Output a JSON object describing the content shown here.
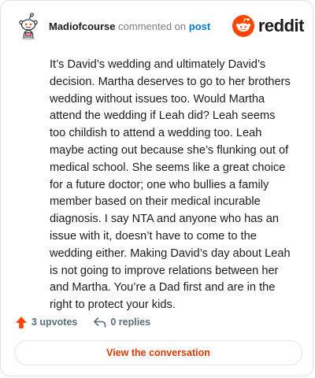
{
  "header": {
    "username": "Madiofcourse",
    "action_text": "commented on",
    "target_text": "post",
    "brand_name": "reddit",
    "brand_color": "#ff4500"
  },
  "comment": {
    "body": "It’s David’s wedding and ultimately David’s decision. Martha deserves to go to her brothers wedding without issues too. Would Martha attend the wedding if Leah did? Leah seems too childish to attend a wedding too. Leah maybe acting out because she’s flunking out of medical school. She seems like a great choice for a future doctor; one who bullies a family member based on their medical incurable diagnosis. I say NTA and anyone who has an issue with it, doesn’t have to come to the wedding either. Making David’s day about Leah is not going to improve relations between her and Martha. You’re a Dad first and are in the right to protect your kids."
  },
  "actions": {
    "upvotes_label": "3 upvotes",
    "replies_label": "0 replies",
    "upvote_icon": "upvote-arrow-icon",
    "reply_icon": "reply-arrow-icon",
    "upvote_color": "#ff4500"
  },
  "cta": {
    "label": "View the conversation",
    "color": "#d93a00"
  }
}
